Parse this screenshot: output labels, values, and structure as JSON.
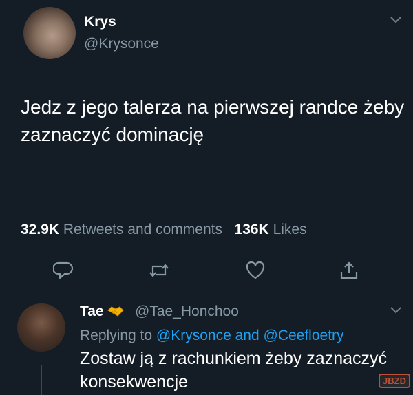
{
  "tweet": {
    "author_name": "Krys",
    "author_handle": "@Krysonce",
    "text": "Jedz z jego talerza na pierwszej randce żeby zaznaczyć dominację",
    "retweets_count": "32.9K",
    "retweets_label": "Retweets and comments",
    "likes_count": "136K",
    "likes_label": "Likes"
  },
  "actions": {
    "reply_icon": "reply-icon",
    "retweet_icon": "retweet-icon",
    "like_icon": "heart-icon",
    "share_icon": "share-icon"
  },
  "reply": {
    "author_name": "Tae",
    "author_badge_icon": "handshake-icon",
    "author_handle": "@Tae_Honchoo",
    "replying_to_prefix": "Replying to",
    "mention1": "@Krysonce",
    "and_text": "and",
    "mention2": "@Ceefloetry",
    "text": "Zostaw ją z rachunkiem żeby zaznaczyć konsekwencje"
  },
  "colors": {
    "background": "#141d26",
    "secondary_text": "#8899a6",
    "link": "#1da1f2"
  }
}
